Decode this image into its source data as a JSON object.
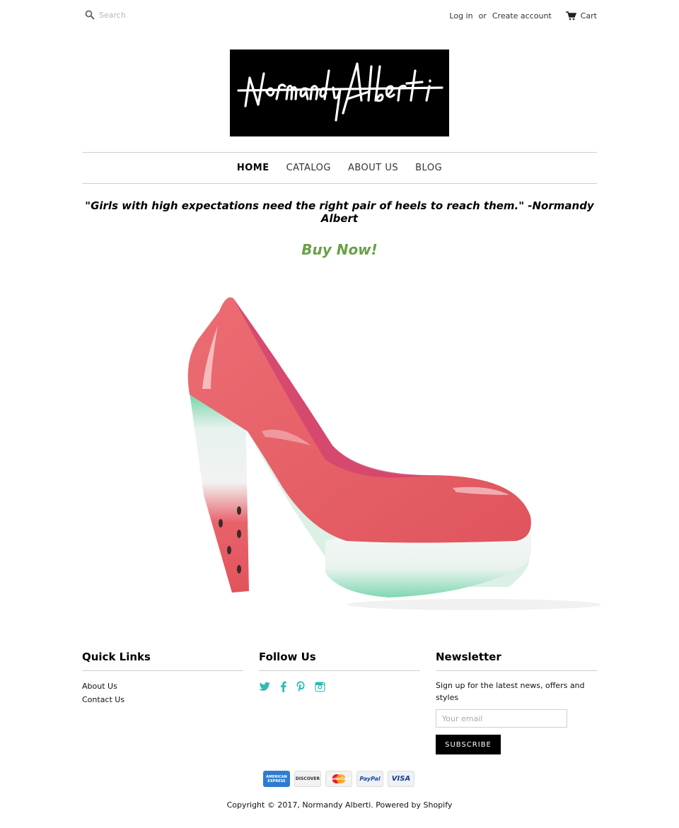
{
  "header": {
    "search_placeholder": "Search",
    "login": "Log in",
    "or": "or",
    "create_account": "Create account",
    "cart": "Cart"
  },
  "logo": {
    "text": "Normandy Alberti"
  },
  "nav": {
    "items": [
      {
        "label": "HOME"
      },
      {
        "label": "CATALOG"
      },
      {
        "label": "ABOUT US"
      },
      {
        "label": "BLOG"
      }
    ]
  },
  "main": {
    "quote": "\"Girls with high expectations need the right pair of heels to reach them.\" -Normandy Albert",
    "buy_now": "Buy Now!"
  },
  "footer": {
    "quick_links": {
      "title": "Quick Links",
      "items": [
        "About Us",
        "Contact Us"
      ]
    },
    "follow_us": {
      "title": "Follow Us",
      "icons": [
        "twitter-icon",
        "facebook-icon",
        "pinterest-icon",
        "instagram-icon"
      ]
    },
    "newsletter": {
      "title": "Newsletter",
      "text": "Sign up for the latest news, offers and styles",
      "email_placeholder": "Your email",
      "subscribe": "SUBSCRIBE"
    },
    "payments": [
      "AMERICAN EXPRESS",
      "DISCOVER",
      "MasterCard",
      "PayPal",
      "VISA"
    ],
    "copyright": "Copyright © 2017, Normandy Alberti. Powered by Shopify"
  },
  "colors": {
    "accent_green": "#6aa048",
    "social_teal": "#2fb9b6",
    "button_black": "#000000"
  }
}
